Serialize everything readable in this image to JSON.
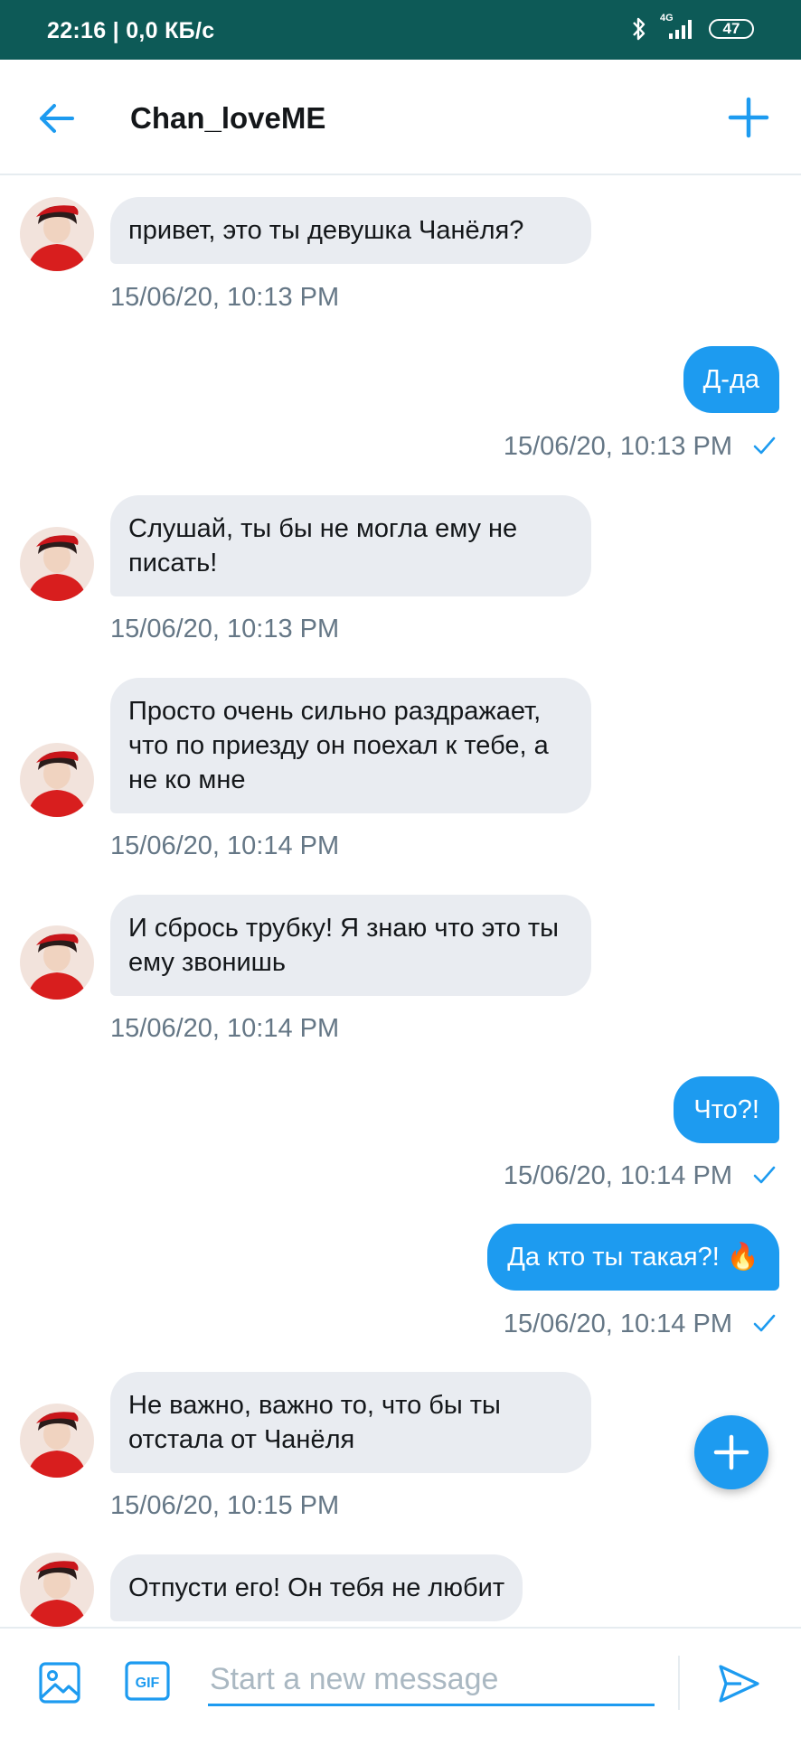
{
  "status_bar": {
    "time_speed": "22:16 | 0,0 КБ/с",
    "network": "4G",
    "battery": "47"
  },
  "header": {
    "title": "Chan_loveME"
  },
  "messages": [
    {
      "dir": "in",
      "text": "привет, это ты девушка Чанёля?",
      "time": "15/06/20, 10:13 PM"
    },
    {
      "dir": "out",
      "text": "Д-да",
      "time": "15/06/20, 10:13 PM"
    },
    {
      "dir": "in",
      "text": "Слушай, ты бы не могла ему не писать!",
      "time": "15/06/20, 10:13 PM"
    },
    {
      "dir": "in",
      "text": "Просто очень сильно раздражает, что по приезду он поехал к тебе, а не ко мне",
      "time": "15/06/20, 10:14 PM"
    },
    {
      "dir": "in",
      "text": "И сбрось трубку! Я знаю что это ты ему звонишь",
      "time": "15/06/20, 10:14 PM"
    },
    {
      "dir": "out",
      "text": "Что?!",
      "time": "15/06/20, 10:14 PM"
    },
    {
      "dir": "out",
      "text": "Да кто ты такая?! 🔥",
      "time": "15/06/20, 10:14 PM"
    },
    {
      "dir": "in",
      "text": "Не важно, важно то, что бы ты отстала от Чанёля",
      "time": "15/06/20, 10:15 PM"
    },
    {
      "dir": "in",
      "text": "Отпусти его! Он тебя не любит",
      "time": ""
    }
  ],
  "composer": {
    "placeholder": "Start a new message"
  },
  "colors": {
    "accent": "#1d9bf0",
    "status_bar": "#0d5a57",
    "incoming_bubble": "#e9ecf1"
  }
}
